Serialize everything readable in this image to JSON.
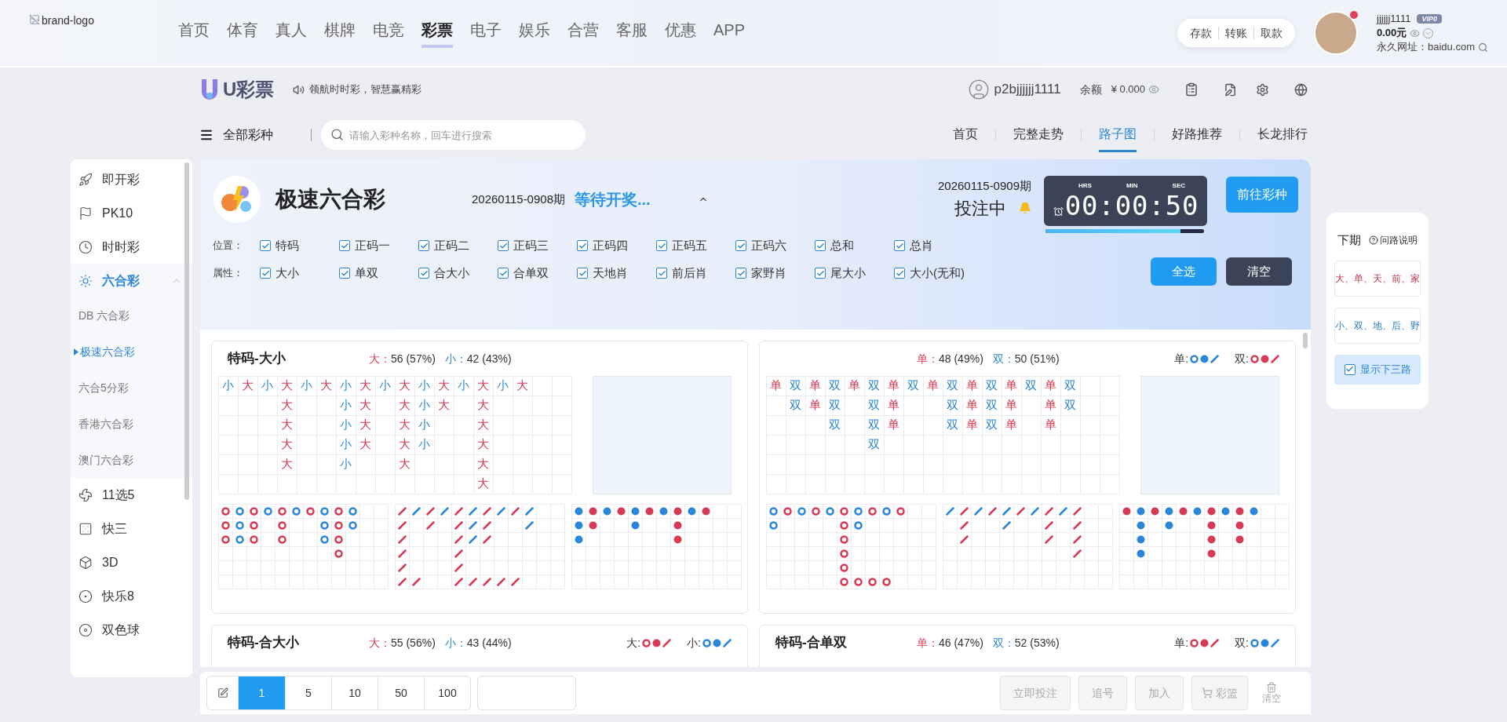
{
  "brand": {
    "alt": "brand-logo"
  },
  "nav": {
    "items": [
      {
        "label": "首页",
        "selected": false
      },
      {
        "label": "体育",
        "selected": false
      },
      {
        "label": "真人",
        "selected": false
      },
      {
        "label": "棋牌",
        "selected": false
      },
      {
        "label": "电竞",
        "selected": false
      },
      {
        "label": "彩票",
        "selected": true
      },
      {
        "label": "电子",
        "selected": false
      },
      {
        "label": "娱乐",
        "selected": false
      },
      {
        "label": "合营",
        "selected": false
      },
      {
        "label": "客服",
        "selected": false
      },
      {
        "label": "优惠",
        "selected": false
      },
      {
        "label": "APP",
        "selected": false
      }
    ]
  },
  "account": {
    "actions": [
      "存款",
      "转账",
      "取款"
    ],
    "notification": true,
    "username": "jjjjjj1111",
    "vip": "VIP0",
    "balance": "0.00元",
    "site": "永久网址：baidu.com"
  },
  "lottery_bar": {
    "logo": "U彩票",
    "slogan": "领航时时彩，智慧赢精彩",
    "user": "p2bjjjjjj1111",
    "balance_label": "余额",
    "balance": "¥ 0.000"
  },
  "category_bar": {
    "menu": "全部彩种",
    "search_placeholder": "请输入彩种名称，回车进行搜索",
    "tabs": [
      {
        "label": "首页",
        "selected": false
      },
      {
        "label": "完整走势",
        "selected": false
      },
      {
        "label": "路子图",
        "selected": true
      },
      {
        "label": "好路推荐",
        "selected": false
      },
      {
        "label": "长龙排行",
        "selected": false
      }
    ]
  },
  "sidebar": {
    "items": [
      {
        "label": "即开彩",
        "kind": "rocket",
        "selected": false
      },
      {
        "label": "PK10",
        "kind": "flag",
        "selected": false
      },
      {
        "label": "时时彩",
        "kind": "clock",
        "selected": false
      },
      {
        "label": "六合彩",
        "kind": "sun",
        "selected": true,
        "expanded": true,
        "children": [
          {
            "label": "DB 六合彩",
            "selected": false
          },
          {
            "label": "极速六合彩",
            "selected": true
          },
          {
            "label": "六合5分彩",
            "selected": false
          },
          {
            "label": "香港六合彩",
            "selected": false
          },
          {
            "label": "澳门六合彩",
            "selected": false
          }
        ]
      },
      {
        "label": "11选5",
        "kind": "fan",
        "selected": false
      },
      {
        "label": "快三",
        "kind": "dice",
        "selected": false
      },
      {
        "label": "3D",
        "kind": "cube",
        "selected": false
      },
      {
        "label": "快乐8",
        "kind": "ball",
        "selected": false
      },
      {
        "label": "双色球",
        "kind": "disc",
        "selected": false
      }
    ]
  },
  "game": {
    "name": "极速六合彩",
    "prev_issue": "20260115-0908期",
    "prev_status": "等待开奖...",
    "next_issue": "20260115-0909期",
    "next_status": "投注中",
    "timer_labels": [
      "HRS",
      "MIN",
      "SEC"
    ],
    "timer": "00:00:50",
    "level": 0.85,
    "goto": "前往彩种"
  },
  "filters": [
    {
      "label": "位置：",
      "options": [
        {
          "label": "特码",
          "checked": true
        },
        {
          "label": "正码一",
          "checked": true
        },
        {
          "label": "正码二",
          "checked": true
        },
        {
          "label": "正码三",
          "checked": true
        },
        {
          "label": "正码四",
          "checked": true
        },
        {
          "label": "正码五",
          "checked": true
        },
        {
          "label": "正码六",
          "checked": true
        },
        {
          "label": "总和",
          "checked": true
        },
        {
          "label": "总肖",
          "checked": true
        }
      ]
    },
    {
      "label": "属性：",
      "options": [
        {
          "label": "大小",
          "checked": true
        },
        {
          "label": "单双",
          "checked": true
        },
        {
          "label": "合大小",
          "checked": true
        },
        {
          "label": "合单双",
          "checked": true
        },
        {
          "label": "天地肖",
          "checked": true
        },
        {
          "label": "前后肖",
          "checked": true
        },
        {
          "label": "家野肖",
          "checked": true
        },
        {
          "label": "尾大小",
          "checked": true
        },
        {
          "label": "大小(无和)",
          "checked": true
        }
      ]
    }
  ],
  "filter_buttons": [
    {
      "label": "全选",
      "kind": "primary"
    },
    {
      "label": "清空",
      "kind": "dark"
    }
  ],
  "cards": [
    {
      "title": "特码-大小",
      "stats": [
        {
          "label": "大：",
          "value": "56 (57%)",
          "kind": "red"
        },
        {
          "label": "小：",
          "value": "42 (43%)",
          "kind": "blue"
        }
      ],
      "big_road": [
        {
          "color": "#2a86d8",
          "cells": [
            "小"
          ]
        },
        {
          "color": "#d63a54",
          "cells": [
            "大"
          ]
        },
        {
          "color": "#2a86d8",
          "cells": [
            "小"
          ]
        },
        {
          "color": "#d63a54",
          "cells": [
            "大",
            "大",
            "大",
            "大",
            "大"
          ]
        },
        {
          "color": "#2a86d8",
          "cells": [
            "小"
          ]
        },
        {
          "color": "#d63a54",
          "cells": [
            "大"
          ]
        },
        {
          "color": "#2a86d8",
          "cells": [
            "小",
            "小",
            "小",
            "小",
            "小"
          ]
        },
        {
          "color": "#d63a54",
          "cells": [
            "大",
            "大",
            "大",
            "大"
          ]
        },
        {
          "color": "#2a86d8",
          "cells": [
            "小"
          ]
        },
        {
          "color": "#d63a54",
          "cells": [
            "大",
            "大",
            "大",
            "大",
            "大"
          ]
        },
        {
          "color": "#2a86d8",
          "cells": [
            "小",
            "小",
            "小",
            "小"
          ]
        },
        {
          "color": "#d63a54",
          "cells": [
            "大",
            "大"
          ]
        },
        {
          "color": "#2a86d8",
          "cells": [
            "小"
          ]
        },
        {
          "color": "#d63a54",
          "cells": [
            "大",
            "大",
            "大",
            "大",
            "大",
            "大"
          ]
        },
        {
          "color": "#2a86d8",
          "cells": [
            "小"
          ]
        },
        {
          "color": "#d63a54",
          "cells": [
            "大"
          ]
        }
      ],
      "roads": [
        {
          "kind": "ring",
          "rows": [
            [
              {
                "color": "#d63a54"
              },
              {
                "color": "#2a86d8"
              },
              {
                "color": "#d63a54"
              },
              {
                "color": "#2a86d8"
              },
              {
                "color": "#d63a54"
              },
              {
                "color": "#2a86d8"
              },
              {
                "color": "#d63a54"
              },
              {
                "color": "#2a86d8"
              },
              {
                "color": "#d63a54"
              },
              {
                "color": "#2a86d8"
              }
            ],
            [
              {
                "color": "#d63a54"
              },
              {
                "color": "#2a86d8"
              },
              {
                "color": "#d63a54"
              },
              null,
              {
                "color": "#d63a54"
              },
              null,
              null,
              {
                "color": "#2a86d8"
              },
              {
                "color": "#d63a54"
              },
              {
                "color": "#2a86d8"
              }
            ],
            [
              {
                "color": "#d63a54"
              },
              {
                "color": "#2a86d8"
              },
              {
                "color": "#d63a54"
              },
              null,
              {
                "color": "#d63a54"
              },
              null,
              null,
              {
                "color": "#2a86d8"
              },
              {
                "color": "#d63a54"
              }
            ],
            [
              null,
              null,
              null,
              null,
              null,
              null,
              null,
              null,
              {
                "color": "#d63a54"
              }
            ]
          ]
        },
        {
          "kind": "slash",
          "rows": [
            [
              {
                "color": "#d63a54"
              },
              {
                "color": "#2a86d8"
              },
              {
                "color": "#d63a54"
              },
              {
                "color": "#2a86d8"
              },
              {
                "color": "#d63a54"
              },
              {
                "color": "#2a86d8"
              },
              {
                "color": "#d63a54"
              },
              {
                "color": "#2a86d8"
              },
              {
                "color": "#d63a54"
              },
              {
                "color": "#2a86d8"
              }
            ],
            [
              {
                "color": "#d63a54"
              },
              null,
              {
                "color": "#d63a54"
              },
              null,
              {
                "color": "#d63a54"
              },
              {
                "color": "#2a86d8"
              },
              {
                "color": "#d63a54"
              },
              null,
              null,
              {
                "color": "#2a86d8"
              }
            ],
            [
              {
                "color": "#d63a54"
              },
              null,
              null,
              null,
              {
                "color": "#d63a54"
              },
              {
                "color": "#2a86d8"
              },
              {
                "color": "#d63a54"
              }
            ],
            [
              {
                "color": "#d63a54"
              },
              null,
              null,
              null,
              {
                "color": "#d63a54"
              }
            ],
            [
              {
                "color": "#d63a54"
              },
              null,
              null,
              null,
              {
                "color": "#d63a54"
              }
            ],
            [
              {
                "color": "#d63a54"
              },
              {
                "color": "#d63a54"
              },
              null,
              null,
              {
                "color": "#d63a54"
              },
              {
                "color": "#d63a54"
              },
              {
                "color": "#d63a54"
              },
              {
                "color": "#d63a54"
              },
              {
                "color": "#d63a54"
              }
            ]
          ]
        },
        {
          "kind": "dot",
          "rows": [
            [
              {
                "color": "#2a86d8"
              },
              {
                "color": "#d63a54"
              },
              {
                "color": "#2a86d8"
              },
              {
                "color": "#d63a54"
              },
              {
                "color": "#2a86d8"
              },
              {
                "color": "#d63a54"
              },
              {
                "color": "#2a86d8"
              },
              {
                "color": "#d63a54"
              },
              {
                "color": "#2a86d8"
              },
              {
                "color": "#d63a54"
              }
            ],
            [
              {
                "color": "#2a86d8"
              },
              {
                "color": "#d63a54"
              },
              null,
              null,
              {
                "color": "#2a86d8"
              },
              null,
              null,
              {
                "color": "#d63a54"
              }
            ],
            [
              {
                "color": "#2a86d8"
              },
              null,
              null,
              null,
              null,
              null,
              null,
              {
                "color": "#d63a54"
              }
            ]
          ]
        }
      ]
    },
    {
      "stats": [
        {
          "label": "单：",
          "value": "48 (49%)",
          "kind": "red"
        },
        {
          "label": "双：",
          "value": "50 (51%)",
          "kind": "blue"
        }
      ],
      "legend": [
        {
          "label": "单:",
          "color": "#2a86d8"
        },
        {
          "label": "双:",
          "color": "#d63a54"
        }
      ],
      "big_road": [
        {
          "color": "#d63a54",
          "cells": [
            "单"
          ]
        },
        {
          "color": "#2a86d8",
          "cells": [
            "双",
            "双"
          ]
        },
        {
          "color": "#d63a54",
          "cells": [
            "单",
            "单"
          ]
        },
        {
          "color": "#2a86d8",
          "cells": [
            "双",
            "双",
            "双"
          ]
        },
        {
          "color": "#d63a54",
          "cells": [
            "单"
          ]
        },
        {
          "color": "#2a86d8",
          "cells": [
            "双",
            "双",
            "双",
            "双"
          ]
        },
        {
          "color": "#d63a54",
          "cells": [
            "单",
            "单",
            "单"
          ]
        },
        {
          "color": "#2a86d8",
          "cells": [
            "双"
          ]
        },
        {
          "color": "#d63a54",
          "cells": [
            "单"
          ]
        },
        {
          "color": "#2a86d8",
          "cells": [
            "双",
            "双",
            "双"
          ]
        },
        {
          "color": "#d63a54",
          "cells": [
            "单",
            "单",
            "单"
          ]
        },
        {
          "color": "#2a86d8",
          "cells": [
            "双",
            "双",
            "双"
          ]
        },
        {
          "color": "#d63a54",
          "cells": [
            "单",
            "单",
            "单"
          ]
        },
        {
          "color": "#2a86d8",
          "cells": [
            "双"
          ]
        },
        {
          "color": "#d63a54",
          "cells": [
            "单",
            "单",
            "单"
          ]
        },
        {
          "color": "#2a86d8",
          "cells": [
            "双",
            "双"
          ]
        }
      ],
      "roads": [
        {
          "kind": "ring",
          "rows": [
            [
              {
                "color": "#2a86d8"
              },
              {
                "color": "#d63a54"
              },
              {
                "color": "#2a86d8"
              },
              {
                "color": "#d63a54"
              },
              {
                "color": "#2a86d8"
              },
              {
                "color": "#d63a54"
              },
              {
                "color": "#2a86d8"
              },
              {
                "color": "#d63a54"
              },
              {
                "color": "#2a86d8"
              },
              {
                "color": "#d63a54"
              }
            ],
            [
              {
                "color": "#2a86d8"
              },
              null,
              null,
              null,
              null,
              {
                "color": "#d63a54"
              },
              {
                "color": "#2a86d8"
              }
            ],
            [
              null,
              null,
              null,
              null,
              null,
              {
                "color": "#d63a54"
              }
            ],
            [
              null,
              null,
              null,
              null,
              null,
              {
                "color": "#d63a54"
              }
            ],
            [
              null,
              null,
              null,
              null,
              null,
              {
                "color": "#d63a54"
              }
            ],
            [
              null,
              null,
              null,
              null,
              null,
              {
                "color": "#d63a54"
              },
              {
                "color": "#d63a54"
              },
              {
                "color": "#d63a54"
              },
              {
                "color": "#d63a54"
              }
            ]
          ]
        },
        {
          "kind": "slash",
          "rows": [
            [
              {
                "color": "#2a86d8"
              },
              {
                "color": "#d63a54"
              },
              {
                "color": "#2a86d8"
              },
              {
                "color": "#d63a54"
              },
              {
                "color": "#2a86d8"
              },
              {
                "color": "#d63a54"
              },
              {
                "color": "#2a86d8"
              },
              {
                "color": "#d63a54"
              },
              {
                "color": "#2a86d8"
              },
              {
                "color": "#d63a54"
              }
            ],
            [
              null,
              {
                "color": "#d63a54"
              },
              null,
              null,
              {
                "color": "#2a86d8"
              },
              null,
              null,
              {
                "color": "#d63a54"
              },
              null,
              {
                "color": "#d63a54"
              }
            ],
            [
              null,
              {
                "color": "#d63a54"
              },
              null,
              null,
              null,
              null,
              null,
              {
                "color": "#d63a54"
              },
              null,
              {
                "color": "#d63a54"
              }
            ],
            [
              null,
              null,
              null,
              null,
              null,
              null,
              null,
              null,
              null,
              {
                "color": "#d63a54"
              }
            ]
          ]
        },
        {
          "kind": "dot",
          "rows": [
            [
              {
                "color": "#d63a54"
              },
              {
                "color": "#2a86d8"
              },
              {
                "color": "#d63a54"
              },
              {
                "color": "#2a86d8"
              },
              {
                "color": "#d63a54"
              },
              {
                "color": "#2a86d8"
              },
              {
                "color": "#d63a54"
              },
              {
                "color": "#2a86d8"
              },
              {
                "color": "#d63a54"
              },
              {
                "color": "#2a86d8"
              }
            ],
            [
              null,
              {
                "color": "#2a86d8"
              },
              null,
              {
                "color": "#2a86d8"
              },
              null,
              null,
              {
                "color": "#d63a54"
              },
              null,
              {
                "color": "#d63a54"
              }
            ],
            [
              null,
              {
                "color": "#2a86d8"
              },
              null,
              null,
              null,
              null,
              {
                "color": "#d63a54"
              },
              null,
              {
                "color": "#d63a54"
              }
            ],
            [
              null,
              {
                "color": "#2a86d8"
              },
              null,
              null,
              null,
              null,
              {
                "color": "#d63a54"
              }
            ]
          ]
        }
      ]
    },
    {
      "title": "特码-合大小",
      "stats": [
        {
          "label": "大：",
          "value": "55 (56%)",
          "kind": "red"
        },
        {
          "label": "小：",
          "value": "43 (44%)",
          "kind": "blue"
        }
      ],
      "legend": [
        {
          "label": "大:",
          "color": "#d63a54"
        },
        {
          "label": "小:",
          "color": "#2a86d8"
        }
      ]
    },
    {
      "title": "特码-合单双",
      "stats": [
        {
          "label": "单：",
          "value": "46 (47%)",
          "kind": "red"
        },
        {
          "label": "双：",
          "value": "52 (53%)",
          "kind": "blue"
        }
      ],
      "legend": [
        {
          "label": "单:",
          "color": "#d63a54"
        },
        {
          "label": "双:",
          "color": "#2a86d8"
        }
      ]
    }
  ],
  "next_panel": {
    "title": "下期",
    "help": "问路说明",
    "predictions": [
      {
        "text": "大、单、天、前、家",
        "kind": "red"
      },
      {
        "text": "小、双、地、后、野",
        "kind": "blue"
      }
    ],
    "toggle": {
      "label": "显示下三路",
      "checked": true
    }
  },
  "bet_bar": {
    "amounts": [
      {
        "label": "1",
        "selected": true
      },
      {
        "label": "5",
        "selected": false
      },
      {
        "label": "10",
        "selected": false
      },
      {
        "label": "50",
        "selected": false
      },
      {
        "label": "100",
        "selected": false
      }
    ],
    "actions": [
      {
        "label": "立即投注",
        "kind": "text",
        "disabled": true
      },
      {
        "label": "追号",
        "kind": "text",
        "disabled": true
      },
      {
        "label": "加入",
        "kind": "text",
        "disabled": true
      },
      {
        "label": "彩篮",
        "kind": "cart",
        "disabled": true
      },
      {
        "label": "清空",
        "kind": "trash",
        "disabled": true
      }
    ]
  }
}
